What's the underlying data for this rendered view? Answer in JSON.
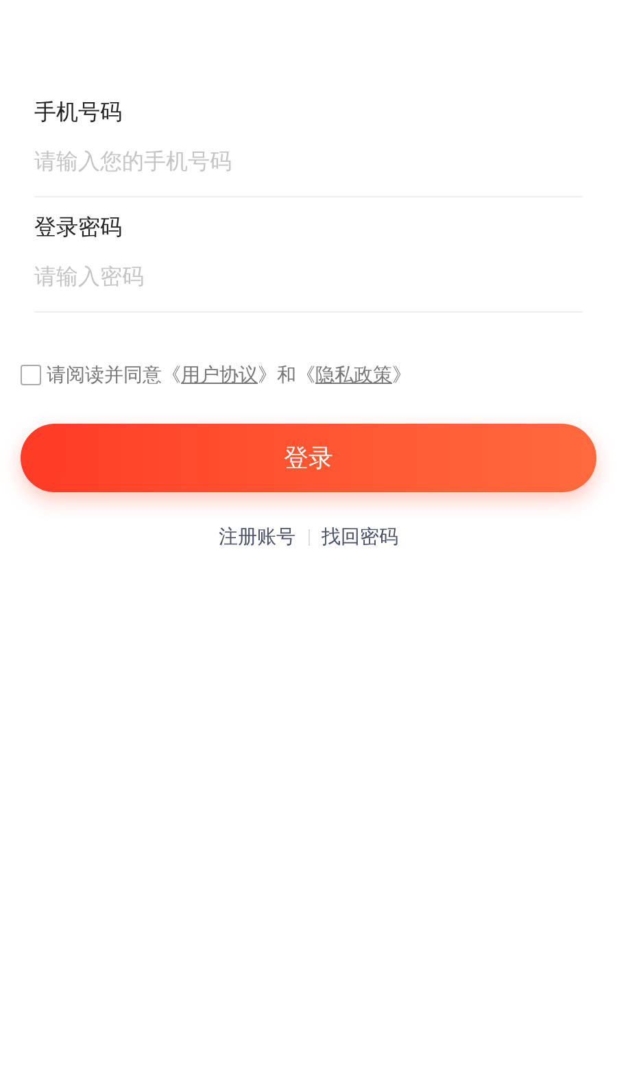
{
  "fields": [
    {
      "label": "手机号码",
      "placeholder": "请输入您的手机号码"
    },
    {
      "label": "登录密码",
      "placeholder": "请输入密码"
    }
  ],
  "agreement": {
    "checked": false,
    "parts": [
      {
        "kind": "text",
        "text": "请阅读并同意《"
      },
      {
        "kind": "link",
        "text": "用户协议"
      },
      {
        "kind": "text",
        "text": "》和《"
      },
      {
        "kind": "link",
        "text": "隐私政策"
      },
      {
        "kind": "text",
        "text": "》"
      }
    ]
  },
  "login_button": "登录",
  "links": [
    "注册账号",
    "找回密码"
  ]
}
